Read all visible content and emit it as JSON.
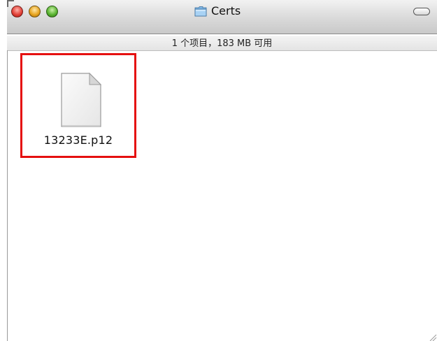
{
  "window": {
    "title": "Certs",
    "status": "1 个项目，183 MB 可用"
  },
  "items": [
    {
      "name": "13233E.p12",
      "icon": "document-icon",
      "selected": true
    }
  ],
  "colors": {
    "highlight": "#e51010",
    "close": "#e2433a",
    "minimize": "#e8a622",
    "zoom": "#5bb532"
  }
}
